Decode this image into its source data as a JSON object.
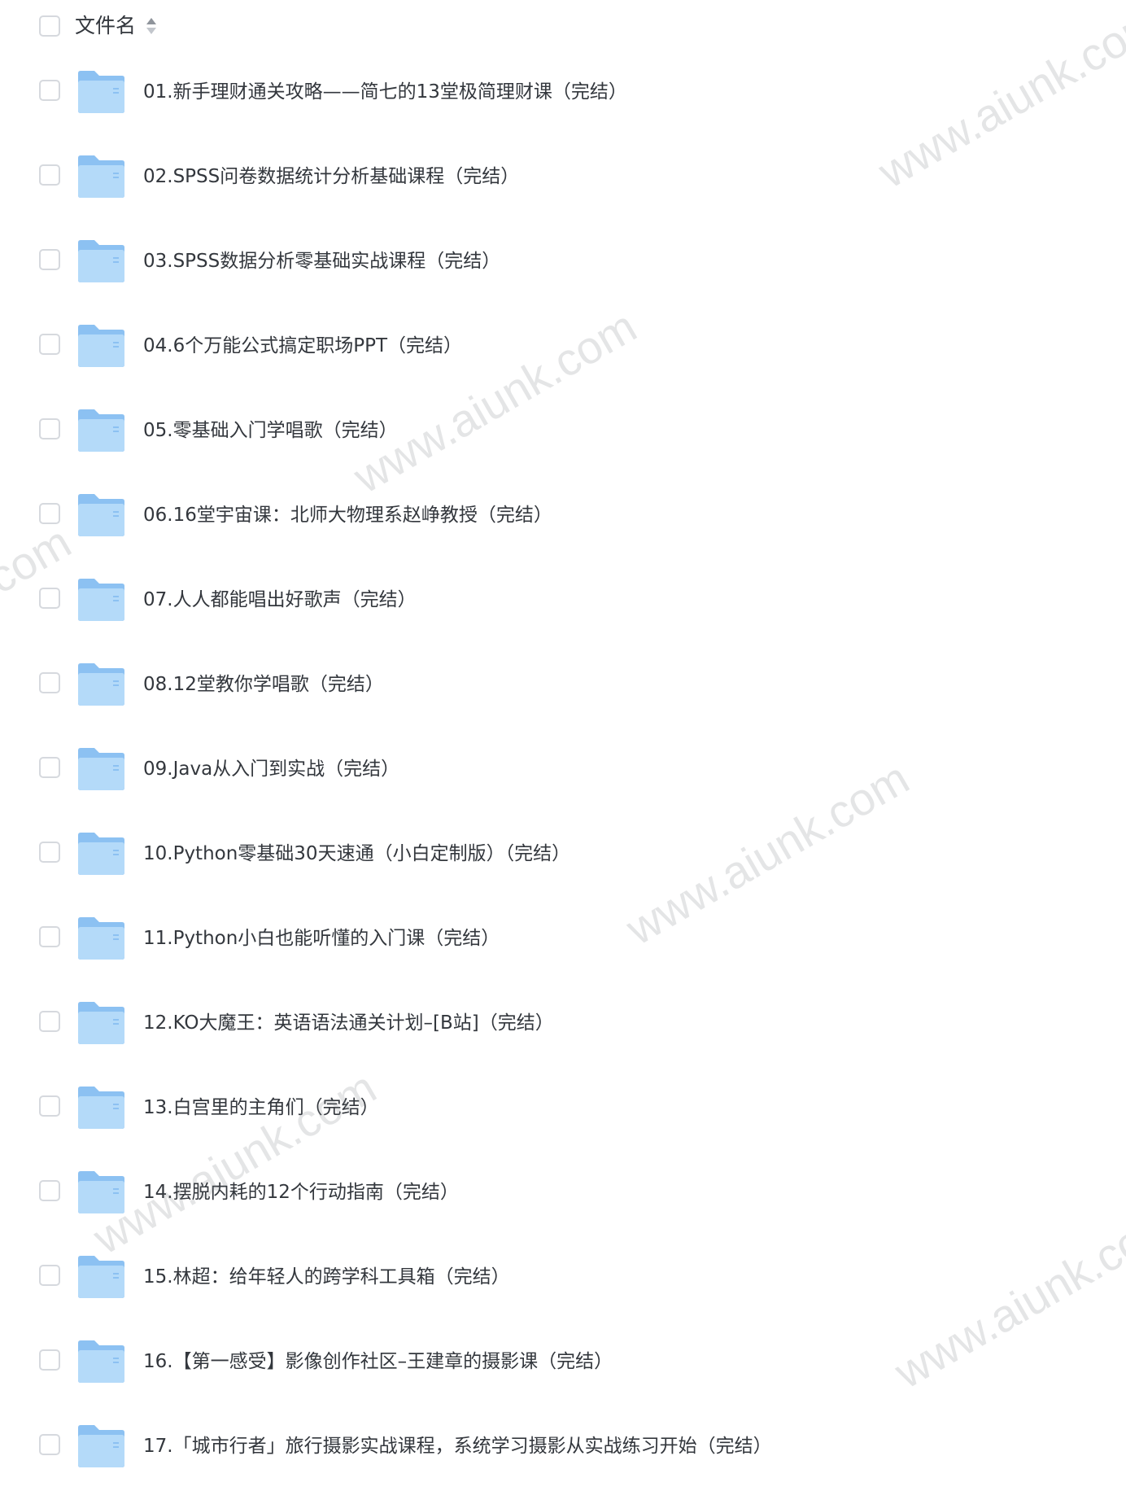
{
  "header": {
    "label": "文件名",
    "sort_icon": "sort-updown-icon"
  },
  "files": [
    {
      "name": "01.新手理财通关攻略——简七的13堂极简理财课（完结）",
      "icon": "folder-icon"
    },
    {
      "name": "02.SPSS问卷数据统计分析基础课程（完结）",
      "icon": "folder-icon"
    },
    {
      "name": "03.SPSS数据分析零基础实战课程（完结）",
      "icon": "folder-icon"
    },
    {
      "name": "04.6个万能公式搞定职场PPT（完结）",
      "icon": "folder-icon"
    },
    {
      "name": "05.零基础入门学唱歌（完结）",
      "icon": "folder-icon"
    },
    {
      "name": "06.16堂宇宙课：北师大物理系赵峥教授（完结）",
      "icon": "folder-icon"
    },
    {
      "name": "07.人人都能唱出好歌声（完结）",
      "icon": "folder-icon"
    },
    {
      "name": "08.12堂教你学唱歌（完结）",
      "icon": "folder-icon"
    },
    {
      "name": "09.Java从入门到实战（完结）",
      "icon": "folder-icon"
    },
    {
      "name": "10.Python零基础30天速通（小白定制版）（完结）",
      "icon": "folder-icon"
    },
    {
      "name": "11.Python小白也能听懂的入门课（完结）",
      "icon": "folder-icon"
    },
    {
      "name": "12.KO大魔王：英语语法通关计划–[B站]（完结）",
      "icon": "folder-icon"
    },
    {
      "name": "13.白宫里的主角们（完结）",
      "icon": "folder-icon"
    },
    {
      "name": "14.摆脱内耗的12个行动指南（完结）",
      "icon": "folder-icon"
    },
    {
      "name": "15.林超：给年轻人的跨学科工具箱（完结）",
      "icon": "folder-icon"
    },
    {
      "name": "16.【第一感受】影像创作社区–王建章的摄影课（完结）",
      "icon": "folder-icon"
    },
    {
      "name": "17.「城市行者」旅行摄影实战课程，系统学习摄影从实战练习开始（完结）",
      "icon": "folder-icon"
    }
  ],
  "watermark": {
    "text": "www.aiunk.com"
  },
  "colors": {
    "folder_back": "#8cc1f2",
    "folder_front": "#b4daf9",
    "text": "#33373d",
    "checkbox_border": "#d6d9de"
  }
}
